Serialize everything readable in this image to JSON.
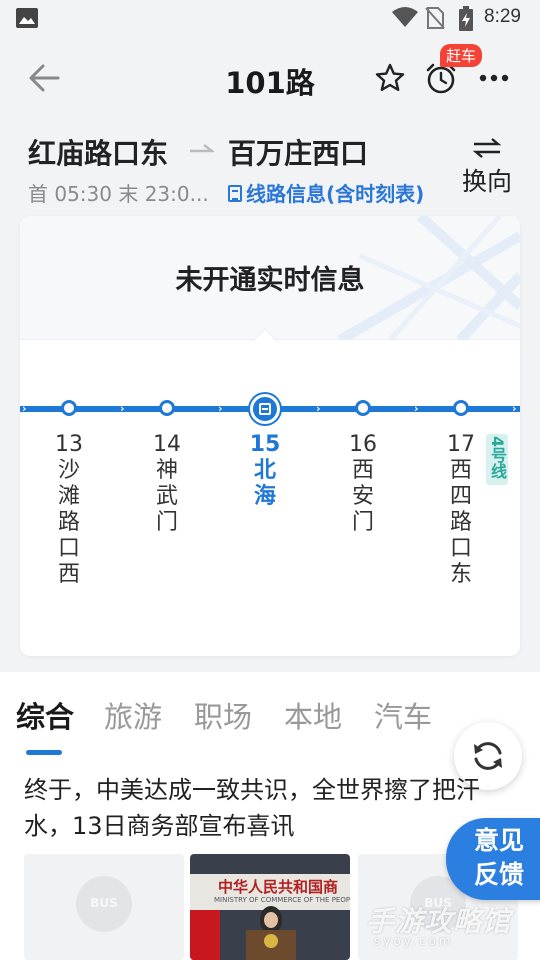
{
  "status_bar": {
    "time": "8:29"
  },
  "header": {
    "title": "101路",
    "alarm_badge": "赶车"
  },
  "route": {
    "from": "红庙路口东",
    "to": "百万庄西口",
    "service_times": "首 05:30 末 23:0...",
    "line_info": "线路信息(含时刻表)",
    "swap_label": "换向"
  },
  "realtime": {
    "message": "未开通实时信息"
  },
  "stops": [
    {
      "number": "13",
      "name": [
        "沙",
        "滩",
        "路",
        "口",
        "西"
      ],
      "current": false
    },
    {
      "number": "14",
      "name": [
        "神",
        "武",
        "门"
      ],
      "current": false
    },
    {
      "number": "15",
      "name": [
        "北",
        "海"
      ],
      "current": true
    },
    {
      "number": "16",
      "name": [
        "西",
        "安",
        "门"
      ],
      "current": false
    },
    {
      "number": "17",
      "name": [
        "西",
        "四",
        "路",
        "口",
        "东"
      ],
      "current": false
    }
  ],
  "metro_tag": "4号线",
  "news": {
    "tabs": [
      "综合",
      "旅游",
      "职场",
      "本地",
      "汽车"
    ],
    "active_tab": 0,
    "headline": "终于，中美达成一致共识，全世界擦了把汗水，13日商务部宣布喜讯",
    "thumb_bus_text": "BUS",
    "photo_banner": "中华人民共和国商",
    "photo_banner_sub": "MINISTRY OF COMMERCE OF THE PEOPLE'S REPUBLIC"
  },
  "feedback": {
    "line1": "意见",
    "line2": "反馈"
  },
  "watermark": {
    "text": "手游攻略馆",
    "sub": "syoy.com"
  },
  "colors": {
    "accent": "#1e78d6",
    "badge": "#f44336",
    "metro": "#2aa89a"
  }
}
